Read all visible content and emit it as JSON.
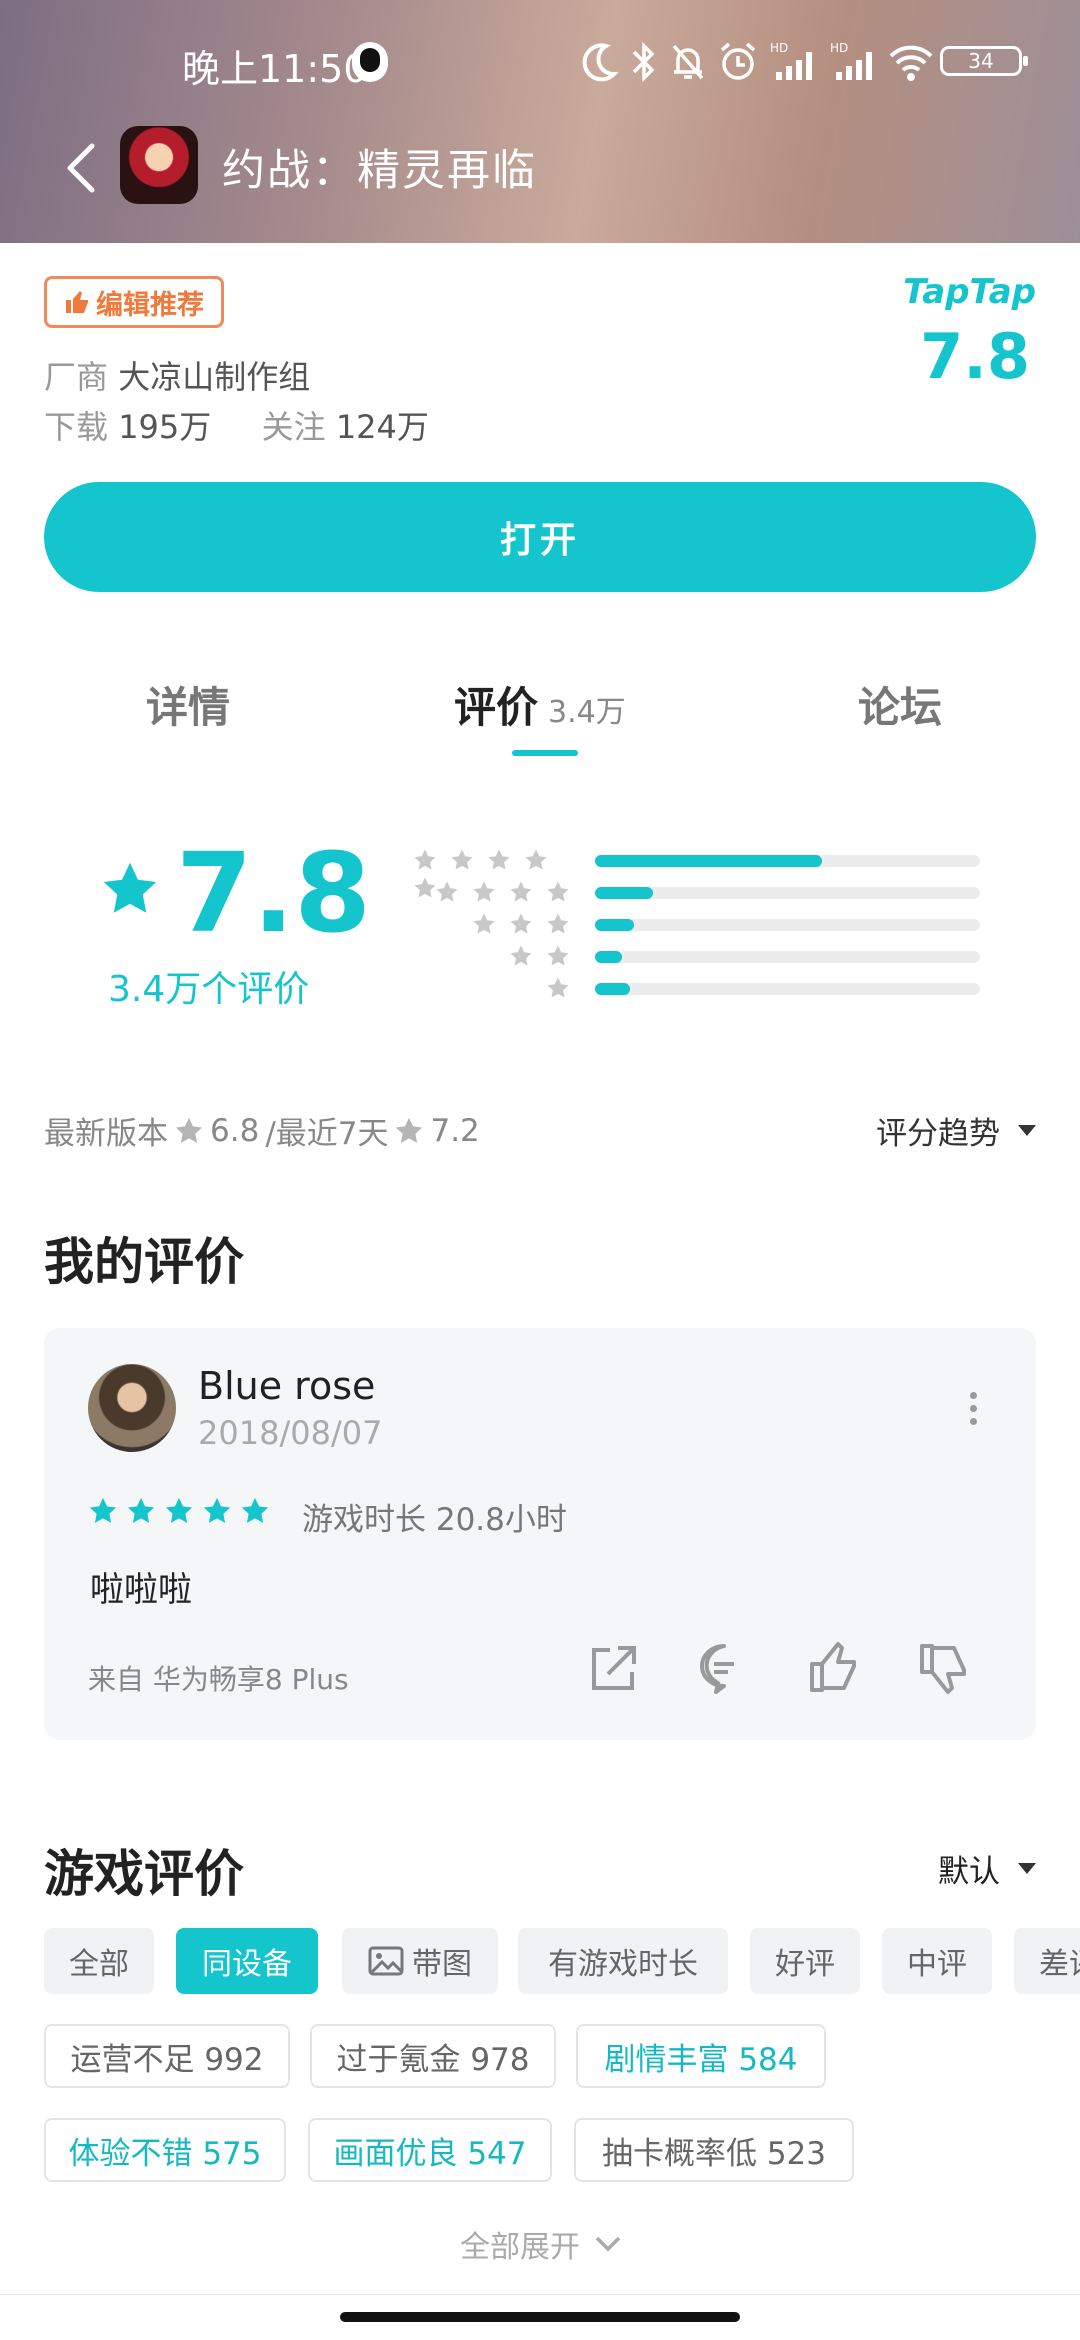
{
  "status_bar": {
    "time": "晚上11:50",
    "battery": "34",
    "icons": [
      "qq-icon",
      "moon-icon",
      "bluetooth-icon",
      "mute-bell-icon",
      "alarm-icon",
      "signal-hd-icon",
      "signal-hd-icon",
      "wifi-icon",
      "battery-icon"
    ]
  },
  "header": {
    "title": "约战：精灵再临"
  },
  "info": {
    "badge": "编辑推荐",
    "vendor_label": "厂商",
    "vendor": "大凉山制作组",
    "download_label": "下载",
    "downloads": "195万",
    "follow_label": "关注",
    "follows": "124万",
    "taptap_logo": "TapTap",
    "taptap_score": "7.8"
  },
  "open_button": "打开",
  "tabs": [
    {
      "label": "详情"
    },
    {
      "label": "评价",
      "count": "3.4万"
    },
    {
      "label": "论坛"
    }
  ],
  "rating": {
    "score": "7.8",
    "count_text": "3.4万个评价",
    "distribution": [
      {
        "stars": 5,
        "fraction": 0.59
      },
      {
        "stars": 4,
        "fraction": 0.15
      },
      {
        "stars": 3,
        "fraction": 0.1
      },
      {
        "stars": 2,
        "fraction": 0.07
      },
      {
        "stars": 1,
        "fraction": 0.09
      }
    ],
    "latest_label": "最新版本",
    "latest_score": "6.8",
    "recent_label": "/最近7天",
    "recent_score": "7.2",
    "trend_label": "评分趋势"
  },
  "my_review": {
    "section_title": "我的评价",
    "username": "Blue rose",
    "date": "2018/08/07",
    "stars": 5,
    "playtime": "游戏时长 20.8小时",
    "text": "啦啦啦",
    "from": "来自  华为畅享8 Plus"
  },
  "game_reviews": {
    "section_title": "游戏评价",
    "sort_label": "默认",
    "filters": [
      "全部",
      "同设备",
      "带图",
      "有游戏时长",
      "好评",
      "中评",
      "差评"
    ],
    "active_filter": "同设备",
    "tags_row1": [
      {
        "label": "运营不足 992",
        "highlight": false
      },
      {
        "label": "过于氪金 978",
        "highlight": false
      },
      {
        "label": "剧情丰富 584",
        "highlight": true
      }
    ],
    "tags_row2": [
      {
        "label": "体验不错 575",
        "highlight": true
      },
      {
        "label": "画面优良 547",
        "highlight": true
      },
      {
        "label": "抽卡概率低 523",
        "highlight": false
      }
    ],
    "expand_label": "全部展开"
  },
  "colors": {
    "accent": "#15c5ce",
    "badge": "#f07a3c",
    "star_gray": "#c8c8c8"
  }
}
